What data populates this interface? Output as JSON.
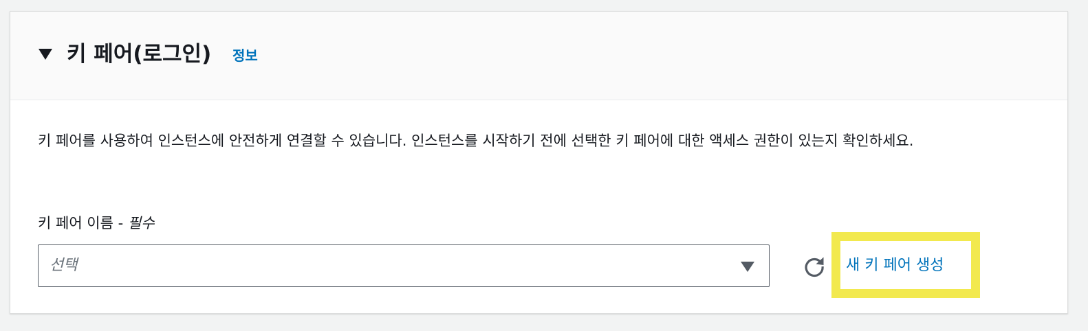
{
  "section": {
    "title": "키 페어(로그인)",
    "info_link": "정보",
    "collapse_icon": "caret-down-icon",
    "description": "키 페어를 사용하여 인스턴스에 안전하게 연결할 수 있습니다. 인스턴스를 시작하기 전에 선택한 키 페어에 대한 액세스 권한이 있는지 확인하세요."
  },
  "key_pair_field": {
    "label": "키 페어 이름 - ",
    "required_text": "필수",
    "placeholder": "선택",
    "dropdown_icon": "caret-down-icon",
    "refresh_icon": "refresh-icon",
    "create_link": "새 키 페어 생성"
  },
  "colors": {
    "link": "#0073bb",
    "highlight": "#f2e94e",
    "header_bg": "#fafafa",
    "text": "#16191f"
  }
}
